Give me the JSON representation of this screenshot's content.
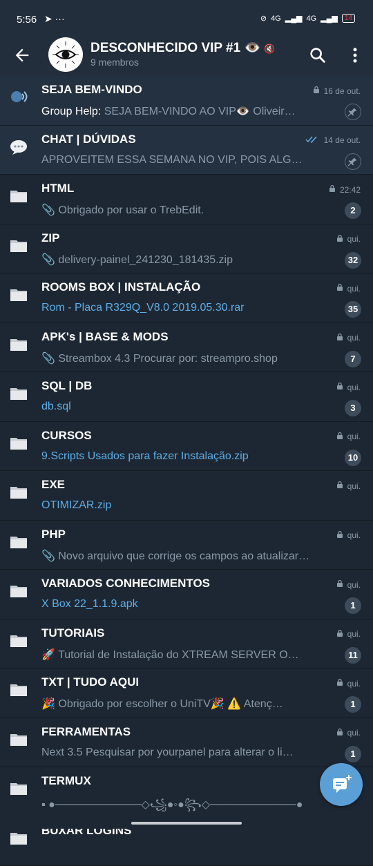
{
  "status": {
    "time": "5:56",
    "signal1": "4G",
    "signal2": "4G",
    "battery": "14"
  },
  "header": {
    "title": "DESCONHECIDO VIP #1",
    "members": "9 membros"
  },
  "rows": [
    {
      "title": "SEJA BEM-VINDO",
      "sender": "Group Help: ",
      "preview": "SEJA BEM-VINDO AO VIP👁️ Oliveir…",
      "time": "16 de out.",
      "pinned": true,
      "icon": "speaking-head-icon"
    },
    {
      "title": "CHAT | DÚVIDAS",
      "preview": "APROVEITEM ESSA SEMANA NO VIP, POIS ALG…",
      "time": "14 de out.",
      "pinned": true,
      "icon": "speech-bubble-icon"
    },
    {
      "title": "HTML",
      "preview": "📎 Obrigado por usar o TrebEdit.",
      "time": "22:42",
      "badge": "2"
    },
    {
      "title": "ZIP",
      "preview": "📎 delivery-painel_241230_181435.zip",
      "time": "qui.",
      "badge": "32"
    },
    {
      "title": "ROOMS BOX | INSTALAÇÃO",
      "preview": "Rom - Placa R329Q_V8.0    2019.05.30.rar",
      "time": "qui.",
      "badge": "35",
      "link": true
    },
    {
      "title": "APK's | BASE & MODS",
      "preview": "📎 Streambox 4.3   Procurar por: streampro.shop",
      "time": "qui.",
      "badge": "7"
    },
    {
      "title": "SQL | DB",
      "preview": "db.sql",
      "time": "qui.",
      "badge": "3",
      "link": true
    },
    {
      "title": "CURSOS",
      "preview": "9.Scripts Usados para fazer Instalação.zip",
      "time": "qui.",
      "badge": "10",
      "link": true
    },
    {
      "title": "EXE",
      "preview": "OTIMIZAR.zip",
      "time": "qui.",
      "link": true
    },
    {
      "title": "PHP",
      "preview": "📎 Novo arquivo que corrige os campos ao atualizar…",
      "time": "qui."
    },
    {
      "title": "VARIADOS CONHECIMENTOS",
      "preview": "X Box 22_1.1.9.apk",
      "time": "qui.",
      "badge": "1",
      "link": true
    },
    {
      "title": "TUTORIAIS",
      "preview": "🚀 Tutorial de Instalação do XTREAM SERVER O…",
      "time": "qui.",
      "badge": "11"
    },
    {
      "title": "TXT | TUDO AQUI",
      "preview": "🎉 Obrigado por escolher o UniTV🎉 ⚠️ Atenç…",
      "time": "qui.",
      "badge": "1"
    },
    {
      "title": "FERRAMENTAS",
      "preview": "Next 3.5  Pesquisar por yourpanel para alterar o li…",
      "time": "qui.",
      "badge": "1"
    },
    {
      "title": "TERMUX",
      "preview": "▪ ●───────────◇꧁●◦●꧂◇───────────●",
      "time": ""
    }
  ],
  "partial_row_title": "BUXAR LOGINS"
}
